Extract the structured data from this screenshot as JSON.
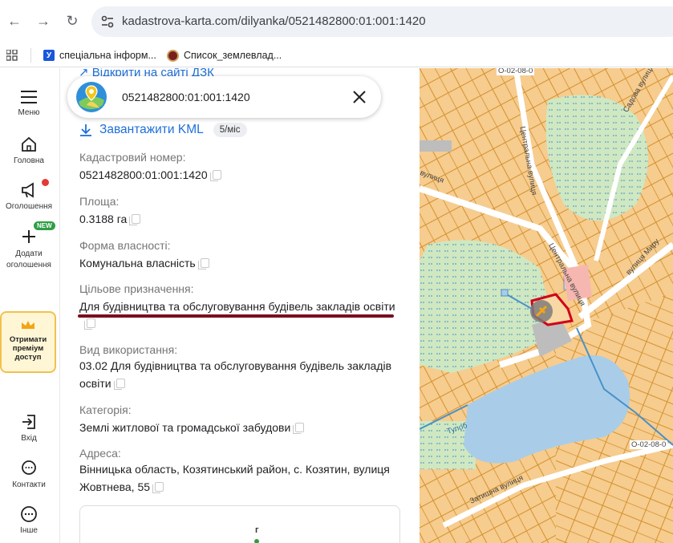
{
  "browser": {
    "url": "kadastrova-karta.com/dilyanka/0521482800:01:001:1420",
    "bookmarks": [
      {
        "label": "спеціальна інформ..."
      },
      {
        "label": "Список_землевлад..."
      }
    ]
  },
  "rail": {
    "menu": "Меню",
    "home": "Головна",
    "ads": "Оголошення",
    "add_ad": "Додати оголошення",
    "new_badge": "NEW",
    "premium": "Отримати преміум доступ",
    "login": "Вхід",
    "contacts": "Контакти",
    "other": "Інше"
  },
  "panel": {
    "open_link": "Відкрити на сайті ДЗК",
    "search_value": "0521482800:01:001:1420",
    "kml_label": "Завантажити KML",
    "kml_price": "5/міс",
    "fields": [
      {
        "label": "Кадастровий номер:",
        "value": "0521482800:01:001:1420"
      },
      {
        "label": "Площа:",
        "value": "0.3188 га"
      },
      {
        "label": "Форма власності:",
        "value": "Комунальна власність"
      },
      {
        "label": "Цільове призначення:",
        "value": "Для будівництва та обслуговування будівель закладів освіти"
      },
      {
        "label": "Вид використання:",
        "value": "03.02 Для будівництва та обслуговування будівель закладів освіти"
      },
      {
        "label": "Категорія:",
        "value": "Землі житлової та громадської забудови"
      },
      {
        "label": "Адреса:",
        "value": "Вінницька область, Козятинський район, с. Козятин, вулиця Жовтнева, 55"
      }
    ],
    "minimap_label": "г"
  },
  "map": {
    "labels": {
      "street1": "Центральна вулиця",
      "street2": "Центральна вулиця",
      "street3": "вулиця Миру",
      "street4": "Садова вулиця",
      "street5": "Затишна вулиця",
      "street6": "вулиця",
      "lake": "Тупоб",
      "code1": "О-02-08-0",
      "code2": "О-02-08-0"
    },
    "colors": {
      "parcel_fill": "#f6cc8f",
      "parcel_stroke": "#d4902a",
      "water": "#a9cde8",
      "green": "#cfe8c1",
      "selected": "#d0021b"
    }
  }
}
